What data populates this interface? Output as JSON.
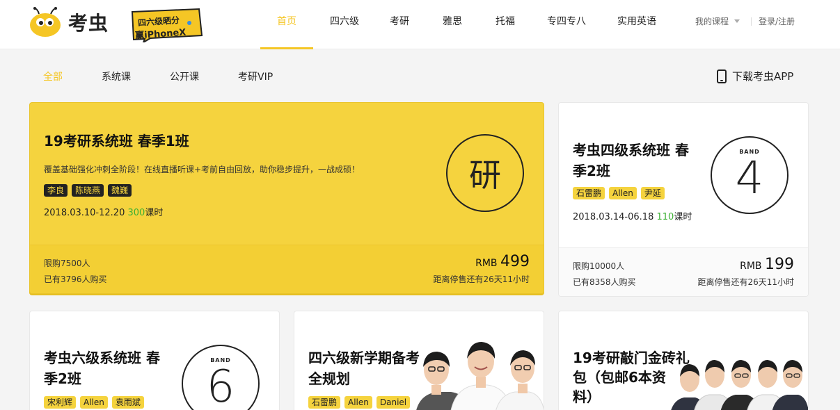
{
  "header": {
    "logo_text": "考虫",
    "promo_line1": "四六级晒分",
    "promo_line2": "赢iPhoneX",
    "nav": [
      "首页",
      "四六级",
      "考研",
      "雅思",
      "托福",
      "专四专八",
      "实用英语"
    ],
    "my_courses": "我的课程",
    "login": "登录/注册"
  },
  "filter": {
    "items": [
      "全部",
      "系统课",
      "公开课",
      "考研VIP"
    ],
    "download": "下载考虫APP"
  },
  "colors": {
    "accent": "#f5c625",
    "card_yellow": "#f5d33e",
    "hours_green": "#3cb034"
  },
  "cards": [
    {
      "title": "19考研系统班 春季1班",
      "desc": "覆盖基础强化冲刺全阶段！在线直播听课+考前自由回放，助你稳步提升，一战成硕！",
      "tags": [
        "李良",
        "陈晓燕",
        "魏巍"
      ],
      "date": "2018.03.10-12.20",
      "hours": "300",
      "hours_unit": "课时",
      "icon_char": "研",
      "limit": "限购7500人",
      "bought": "已有3796人购买",
      "currency": "RMB",
      "price": "499",
      "countdown": "距离停售还有26天11小时"
    },
    {
      "title_line1": "考虫四级系统班 春",
      "title_line2": "季2班",
      "tags": [
        "石雷鹏",
        "Allen",
        "尹延"
      ],
      "date": "2018.03.14-06.18",
      "hours": "110",
      "hours_unit": "课时",
      "band_label": "BAND",
      "band_num": "4",
      "limit": "限购10000人",
      "bought": "已有8358人购买",
      "currency": "RMB",
      "price": "199",
      "countdown": "距离停售还有26天11小时"
    },
    {
      "title_line1": "考虫六级系统班 春",
      "title_line2": "季2班",
      "tags": [
        "宋利辉",
        "Allen",
        "袁雨斌"
      ],
      "band_label": "BAND",
      "band_num": "6"
    },
    {
      "title_line1": "四六级新学期备考",
      "title_line2": "全规划",
      "tags": [
        "石雷鹏",
        "Allen",
        "Daniel"
      ]
    },
    {
      "title_line1": "19考研敲门金砖礼",
      "title_line2": "包（包邮6本资",
      "title_line3": "料）"
    }
  ]
}
